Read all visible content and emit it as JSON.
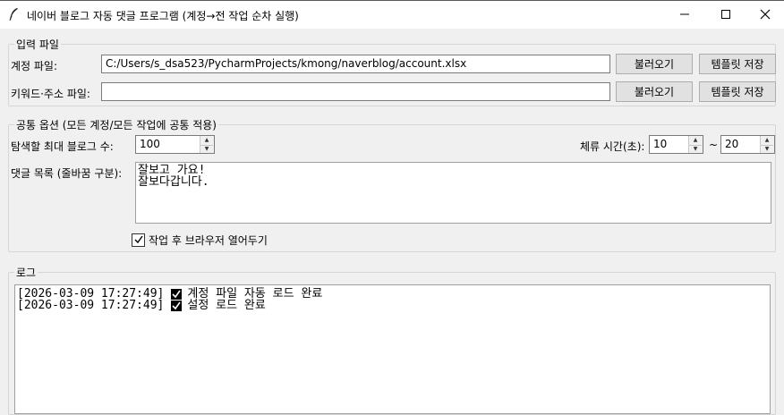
{
  "window": {
    "title": "네이버 블로그 자동 댓글 프로그램 (계정→전 작업 순차 실행)",
    "minimize_icon": "minimize-icon",
    "maximize_icon": "maximize-icon",
    "close_icon": "close-icon"
  },
  "input_files": {
    "legend": "입력 파일",
    "account_label": "계정 파일:",
    "account_value": "C:/Users/s_dsa523/PycharmProjects/kmong/naverblog/account.xlsx",
    "keyword_label": "키워드·주소 파일:",
    "keyword_value": "",
    "load_label": "불러오기",
    "template_label": "템플릿 저장"
  },
  "options": {
    "legend": "공통 옵션 (모든 계정/모든 작업에 공통 적용)",
    "max_blogs_label": "탐색할 최대 블로그 수:",
    "max_blogs_value": "100",
    "stay_time_label": "체류 시간(초):",
    "stay_min": "10",
    "tilde": "~",
    "stay_max": "20",
    "comments_label": "댓글 목록 (줄바꿈 구분):",
    "comments": [
      "잘보고 가요!",
      "잘보다갑니다."
    ],
    "keep_browser_label": "작업 후 브라우저 열어두기",
    "keep_browser_checked": true
  },
  "log": {
    "legend": "로그",
    "lines": [
      {
        "time": "[2026-03-09 17:27:49]",
        "text": "계정 파일 자동 로드 완료"
      },
      {
        "time": "[2026-03-09 17:27:49]",
        "text": "설정 로드 완료"
      }
    ]
  }
}
